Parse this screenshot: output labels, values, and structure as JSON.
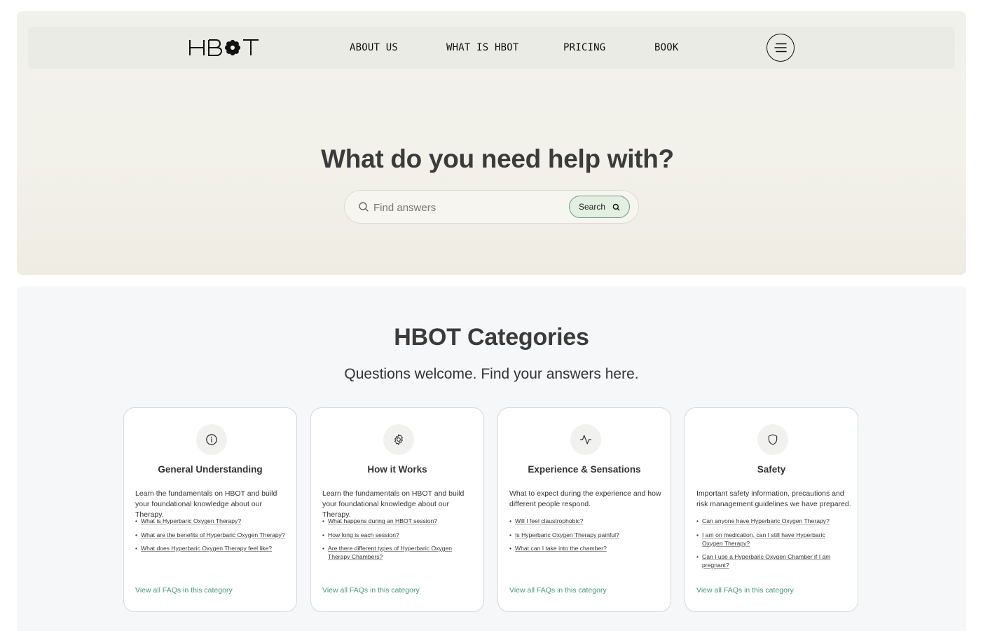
{
  "brand": {
    "logo_text": "HBOT"
  },
  "nav": {
    "links": [
      "ABOUT US",
      "WHAT IS HBOT",
      "PRICING",
      "BOOK"
    ],
    "menu_icon": "hamburger-menu-icon"
  },
  "hero": {
    "title": "What do you need help with?",
    "search": {
      "placeholder": "Find answers",
      "value": "",
      "button_label": "Search",
      "icon": "search-icon"
    }
  },
  "categories": {
    "title": "HBOT Categories",
    "subtitle": "Questions welcome. Find your answers here.",
    "cards": [
      {
        "icon": "info-icon",
        "title": "General Understanding",
        "description": "Learn the fundamentals on HBOT and build your foundational knowledge about our Therapy.",
        "questions": [
          "What is Hyperbaric Oxygen Therapy?",
          "What are the benefits of Hyperbaric Oxygen Therapy?",
          "What does Hyperbaric Oxygen Therapy feel like?"
        ],
        "link": "View all FAQs in this category"
      },
      {
        "icon": "gear-icon",
        "title": "How it Works",
        "description": "Learn the fundamentals on HBOT and build your foundational knowledge about our Therapy.",
        "questions": [
          "What happens during an HBOT session?",
          "How long is each session?",
          "Are there different types of Hyperbaric Oxygen Therapy Chambers?"
        ],
        "link": "View all FAQs in this category"
      },
      {
        "icon": "activity-pulse-icon",
        "title": "Experience & Sensations",
        "description": "What to expect during the experience and how different people respond.",
        "questions": [
          "Will I feel claustrophobic?",
          "Is Hyperbaric Oxygen Therapy painful?",
          "What can I take into the chamber?"
        ],
        "link": "View all FAQs in this category"
      },
      {
        "icon": "shield-icon",
        "title": "Safety",
        "description": "Important safety information, precautions and risk management guidelines we have prepared.",
        "questions": [
          "Can anyone have Hyperbaric Oxygen Therapy?",
          "I am on medication, can I still have Hyperbaric Oxygen Therapy?",
          "Can I use a Hyperbaric Oxygen Chamber if I am pregnant?"
        ],
        "link": "View all FAQs in this category"
      }
    ]
  },
  "colors": {
    "accent_green": "#4a9477",
    "search_button_bg": "#e3efe0",
    "heading": "#3b3b3b"
  }
}
